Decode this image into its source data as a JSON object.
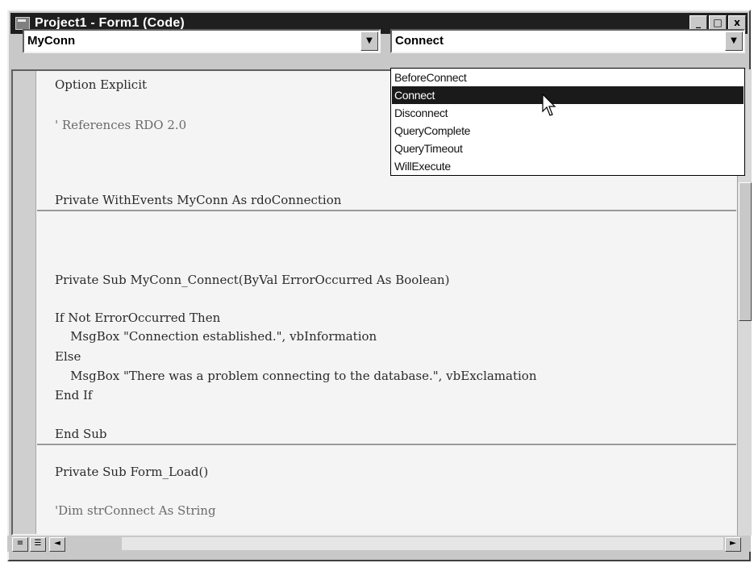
{
  "window": {
    "title": "Project1 - Form1 (Code)",
    "controls": {
      "minimize": "_",
      "maximize": "□",
      "close": "x"
    }
  },
  "object_combo": {
    "value": "MyConn"
  },
  "procedure_combo": {
    "value": "Connect"
  },
  "dropdown": {
    "items": [
      "BeforeConnect",
      "Connect",
      "Disconnect",
      "QueryComplete",
      "QueryTimeout",
      "WillExecute"
    ],
    "selected": "Connect"
  },
  "code": {
    "lines": [
      "Option Explicit",
      "' References RDO 2.0",
      "Private WithEvents MyConn As rdoConnection",
      "Private Sub MyConn_Connect(ByVal ErrorOccurred As Boolean)",
      "If Not ErrorOccurred Then",
      "    MsgBox \"Connection established.\", vbInformation",
      "Else",
      "    MsgBox \"There was a problem connecting to the database.\", vbExclamation",
      "End If",
      "End Sub",
      "Private Sub Form_Load()",
      "'Dim strConnect As String"
    ]
  },
  "icons": {
    "app": "code-window-icon",
    "combo_arrow": "▼",
    "scroll_left": "◄",
    "scroll_right": "►"
  }
}
